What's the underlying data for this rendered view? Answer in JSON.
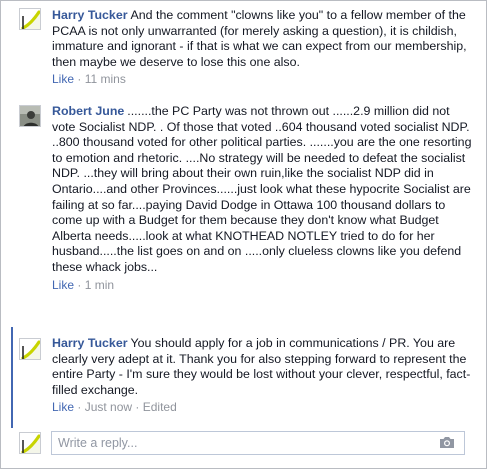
{
  "comments": [
    {
      "author": "Harry Tucker",
      "text": "And the comment \"clowns like you\" to a fellow member of the PCAA is not only unwarranted (for merely asking a question), it is childish, immature and ignorant - if that is what we can expect from our membership, then maybe we deserve to lose this one also.",
      "like_label": "Like",
      "time": "11 mins",
      "avatar_icon": "default-avatar-icon"
    },
    {
      "author": "Robert June",
      "text": ".......the PC Party was not thrown out ......2.9 million did not vote Socialist NDP. . Of those that voted ..604 thousand voted socialist NDP. ..800 thousand voted for other political parties. .......you are the one resorting to emotion and rhetoric. ....No strategy will be needed to defeat the socialist NDP. ...they will bring about their own ruin,like the socialist NDP did in Ontario....and other Provinces......just look what these hypocrite Socialist are failing at so far....paying David Dodge in Ottawa 100 thousand dollars to come up with a Budget for them because they don't know what Budget Alberta needs.....look at what KNOTHEAD NOTLEY tried to do for her husband.....the list goes on and on .....only clueless clowns like you defend these whack jobs...",
      "like_label": "Like",
      "time": "1 min",
      "avatar_icon": "profile-photo-icon"
    },
    {
      "author": "Harry Tucker",
      "text": "You should apply for a job in communications / PR. You are clearly very adept at it. Thank you for also stepping forward to represent the entire Party - I'm sure they would be lost without your clever, respectful, fact-filled exchange.",
      "like_label": "Like",
      "time": "Just now",
      "edited": "Edited",
      "avatar_icon": "default-avatar-icon"
    }
  ],
  "reply_box": {
    "placeholder": "Write a reply...",
    "camera_icon": "camera-icon"
  },
  "meta_separator": "·",
  "colors": {
    "author_link": "#365899",
    "action_link": "#4267b2",
    "meta_text": "#90949c",
    "thread_bar": "#4267b2"
  }
}
